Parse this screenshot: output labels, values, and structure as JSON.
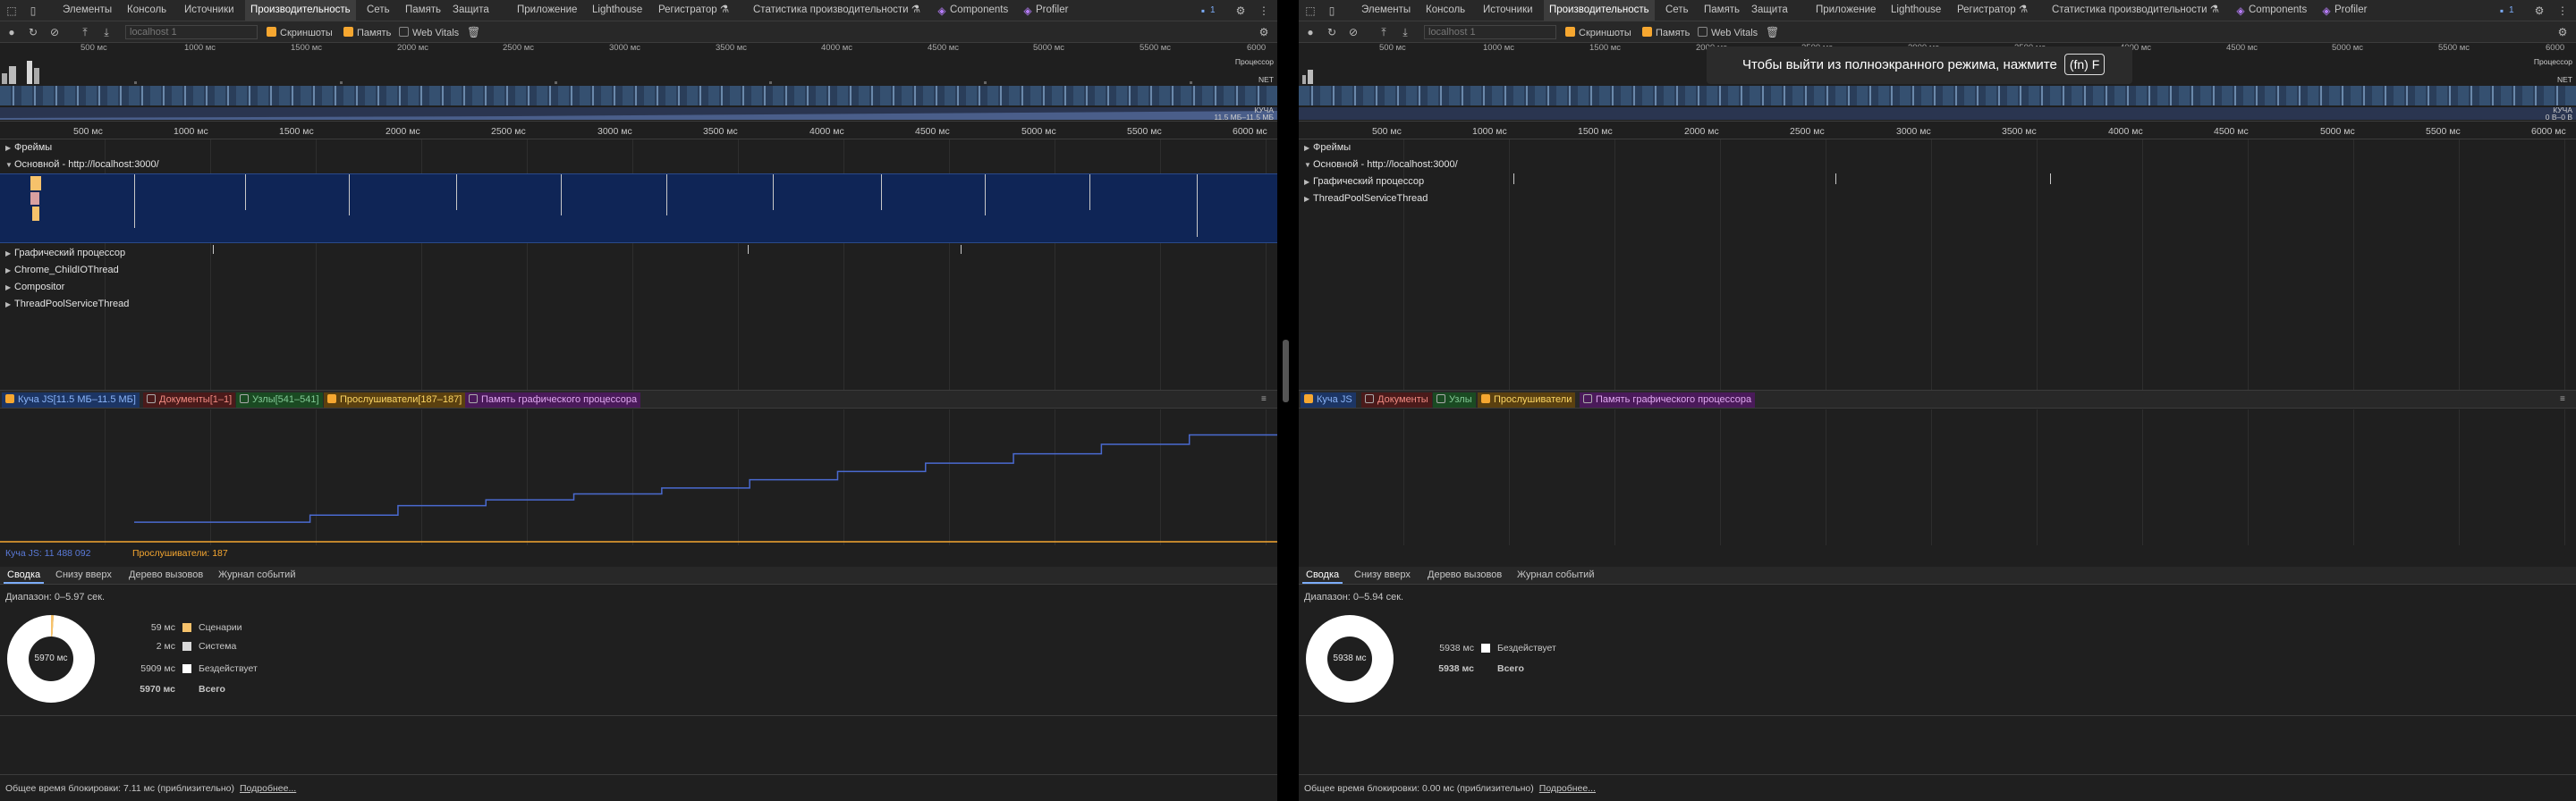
{
  "tabs": [
    "Элементы",
    "Консоль",
    "Источники",
    "Производительность",
    "Сеть",
    "Память",
    "Защита",
    "Приложение",
    "Lighthouse",
    "Регистратор ⚗",
    "Статистика производительности ⚗",
    "Components",
    "Profiler"
  ],
  "tab_badge": "1",
  "toolbar": {
    "url_placeholder": "localhost 1",
    "screenshots_label": "Скриншоты",
    "memory_label": "Память",
    "webvitals_label": "Web Vitals"
  },
  "left": {
    "overview_ticks": [
      "500 мс",
      "1000 мс",
      "1500 мс",
      "2000 мс",
      "2500 мс",
      "3000 мс",
      "3500 мс",
      "4000 мс",
      "4500 мс",
      "5000 мс",
      "5500 мс",
      "6000"
    ],
    "overview_labels": {
      "cpu": "Процессор",
      "net": "NET",
      "heap": "КУЧА",
      "heap_range": "11.5 МБ–11.5 МБ"
    },
    "main_ticks": [
      "500 мс",
      "1000 мс",
      "1500 мс",
      "2000 мс",
      "2500 мс",
      "3000 мс",
      "3500 мс",
      "4000 мс",
      "4500 мс",
      "5000 мс",
      "5500 мс",
      "6000 мс"
    ],
    "tracks": {
      "frames": "Фреймы",
      "main": "Основной - http://localhost:3000/",
      "gpu": "Графический процессор",
      "io": "Chrome_ChildIOThread",
      "compositor": "Compositor",
      "threadpool": "ThreadPoolServiceThread"
    },
    "legend": {
      "heap": "Куча JS[11.5 МБ–11.5 МБ]",
      "docs": "Документы[1–1]",
      "nodes": "Узлы[541–541]",
      "listeners": "Прослушиватели[187–187]",
      "gpu_mem": "Память графического процессора"
    },
    "mem_footer": {
      "heap": "Куча JS: 11 488 092",
      "listeners": "Прослушиватели: 187"
    },
    "heap_series": [
      0.12,
      0.12,
      0.18,
      0.26,
      0.31,
      0.36,
      0.41,
      0.48,
      0.55,
      0.62,
      0.7,
      0.78,
      0.86
    ],
    "bottom_tabs": [
      "Сводка",
      "Снизу вверх",
      "Дерево вызовов",
      "Журнал событий"
    ],
    "range": "Диапазон: 0–5.97 сек.",
    "donut_total": "5970 мс",
    "summary": [
      {
        "value": "59 мс",
        "label": "Сценарии",
        "color": "#f6c26b"
      },
      {
        "value": "2 мс",
        "label": "Система",
        "color": "#d9d9d9"
      },
      {
        "value": "5909 мс",
        "label": "Бездействует",
        "color": "#ffffff"
      },
      {
        "value": "5970 мс",
        "label": "Всего",
        "color": ""
      }
    ],
    "blocking": "Общее время блокировки: 7.11 мс  (приблизительно)",
    "more_link": "Подробнее..."
  },
  "right": {
    "overview_ticks": [
      "500 мс",
      "1000 мс",
      "1500 мс",
      "2000 мс",
      "2500 мс",
      "3000 мс",
      "3500 мс",
      "4000 мс",
      "4500 мс",
      "5000 мс",
      "5500 мс",
      "6000"
    ],
    "overview_labels": {
      "cpu": "Процессор",
      "net": "NET",
      "heap": "КУЧА",
      "heap_range": "0 B–0 B"
    },
    "main_ticks": [
      "500 мс",
      "1000 мс",
      "1500 мс",
      "2000 мс",
      "2500 мс",
      "3000 мс",
      "3500 мс",
      "4000 мс",
      "4500 мс",
      "5000 мс",
      "5500 мс",
      "6000 мс"
    ],
    "tracks": {
      "frames": "Фреймы",
      "main": "Основной - http://localhost:3000/",
      "gpu": "Графический процессор",
      "threadpool": "ThreadPoolServiceThread"
    },
    "legend": {
      "heap": "Куча JS",
      "docs": "Документы",
      "nodes": "Узлы",
      "listeners": "Прослушиватели",
      "gpu_mem": "Память графического процессора"
    },
    "bottom_tabs": [
      "Сводка",
      "Снизу вверх",
      "Дерево вызовов",
      "Журнал событий"
    ],
    "range": "Диапазон: 0–5.94 сек.",
    "donut_total": "5938 мс",
    "summary": [
      {
        "value": "5938 мс",
        "label": "Бездействует",
        "color": "#ffffff"
      },
      {
        "value": "5938 мс",
        "label": "Всего",
        "color": ""
      }
    ],
    "blocking": "Общее время блокировки: 0.00 мс  (приблизительно)",
    "more_link": "Подробнее..."
  },
  "fullscreen_toast": {
    "text": "Чтобы выйти из полноэкранного режима, нажмите",
    "key": "(fn) F"
  }
}
